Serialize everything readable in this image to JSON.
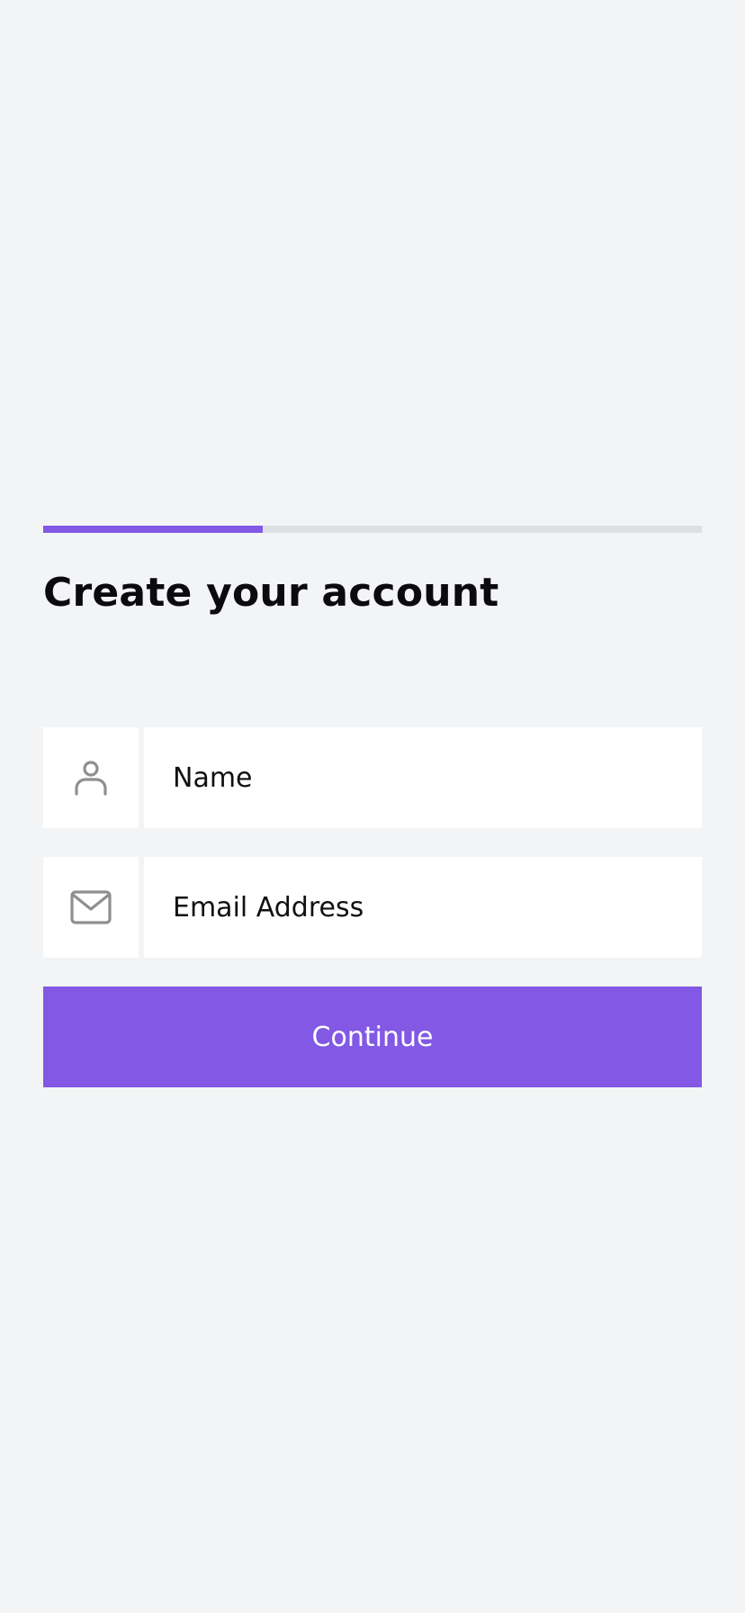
{
  "progress": {
    "fraction": 0.333
  },
  "header": {
    "title": "Create your account"
  },
  "form": {
    "name": {
      "placeholder": "Name",
      "icon": "user-icon"
    },
    "email": {
      "placeholder": "Email Address",
      "icon": "mail-icon"
    },
    "continue_label": "Continue"
  },
  "colors": {
    "accent": "#8258e4",
    "background": "#f3f4f6",
    "track": "#dfe0e3",
    "icon": "#8f8f8f"
  }
}
